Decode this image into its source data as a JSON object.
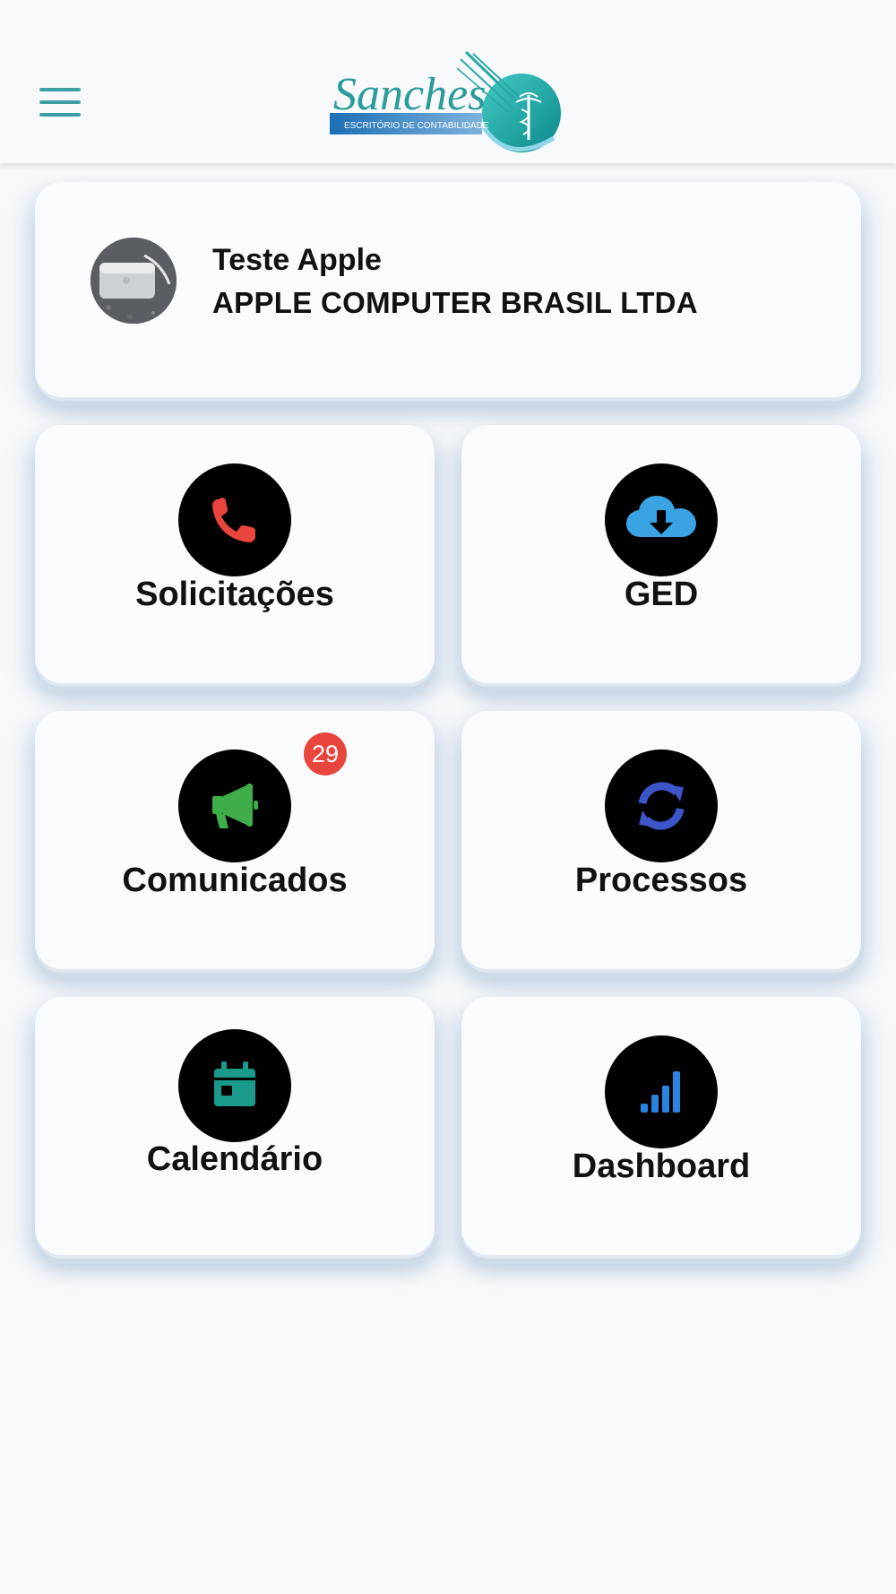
{
  "header": {
    "menu_icon": "hamburger-menu-icon",
    "logo": {
      "name": "Sanches",
      "tagline": "ESCRITÓRIO DE CONTABILIDADE"
    }
  },
  "profile": {
    "name": "Teste Apple",
    "company": "APPLE COMPUTER BRASIL LTDA"
  },
  "tiles": [
    {
      "label": "Solicitações",
      "icon": "phone-icon",
      "color": "#e8453c"
    },
    {
      "label": "GED",
      "icon": "cloud-download-icon",
      "color": "#3aa3e3"
    },
    {
      "label": "Comunicados",
      "icon": "megaphone-icon",
      "color": "#3fae49",
      "badge": "29"
    },
    {
      "label": "Processos",
      "icon": "sync-icon",
      "color": "#3c55c8"
    },
    {
      "label": "Calendário",
      "icon": "calendar-icon",
      "color": "#1a9a8b"
    },
    {
      "label": "Dashboard",
      "icon": "signal-bars-icon",
      "color": "#2b83e0"
    }
  ],
  "colors": {
    "accent": "#3d9fa3",
    "badge": "#e8453c"
  }
}
